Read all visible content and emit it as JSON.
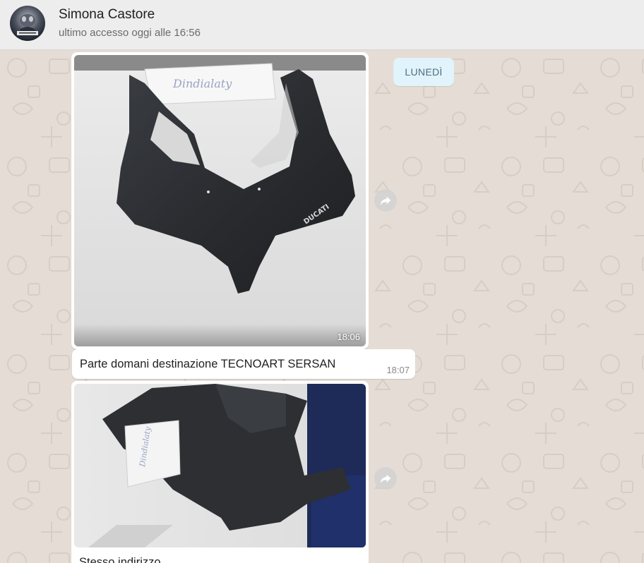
{
  "header": {
    "contact_name": "Simona Castore",
    "status": "ultimo accesso oggi alle 16:56"
  },
  "chat": {
    "day_chip": "LUNEDÌ",
    "messages": [
      {
        "kind": "photo",
        "subject": "ducati-front-fairing",
        "paper_note": "Dindialaty",
        "logo_text": "DUCATI",
        "time": "18:06"
      },
      {
        "kind": "text",
        "text": "Parte domani destinazione TECNOART SERSAN",
        "time": "18:07"
      },
      {
        "kind": "photo",
        "subject": "ducati-side-fairing",
        "paper_note": "Dindialaty",
        "caption": "Stesso indirizzo"
      }
    ]
  },
  "colors": {
    "chat_bg": "#e5ddd5",
    "header_bg": "#ededed",
    "bubble": "#ffffff",
    "day_chip_bg": "#e1f3fb"
  },
  "icons": [
    "forward-icon",
    "avatar"
  ]
}
